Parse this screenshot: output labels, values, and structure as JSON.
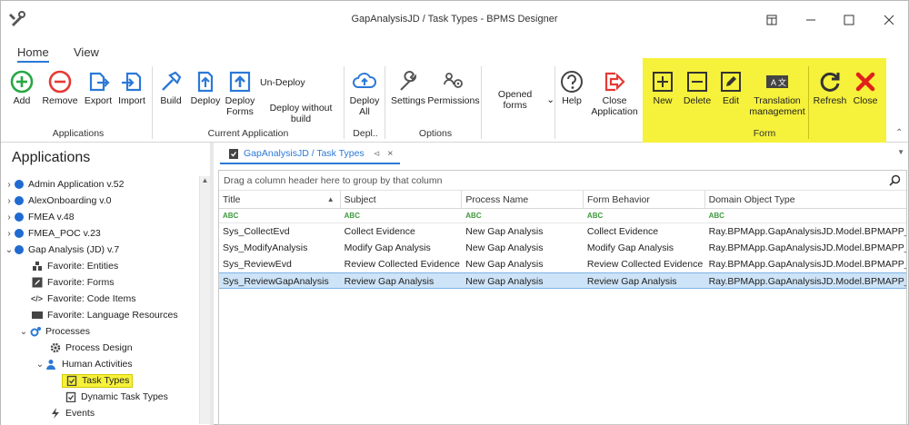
{
  "window": {
    "title": "GapAnalysisJD / Task Types - BPMS Designer"
  },
  "menu": {
    "tabs": [
      "Home",
      "View"
    ]
  },
  "ribbon": {
    "buttons": {
      "add": "Add",
      "remove": "Remove",
      "export": "Export",
      "import": "Import",
      "build": "Build",
      "deploy": "Deploy",
      "deploy_forms": "Deploy Forms",
      "undeploy": "Un-Deploy",
      "deploy_without_build": "Deploy without build",
      "deploy_all": "Deploy All",
      "settings": "Settings",
      "permissions": "Permissions",
      "opened_forms": "Opened forms",
      "help": "Help",
      "close_application": "Close Application",
      "new": "New",
      "delete": "Delete",
      "edit": "Edit",
      "translation_management": "Translation management",
      "refresh": "Refresh",
      "close": "Close"
    },
    "groups": {
      "applications": "Applications",
      "current_application": "Current Application",
      "depl": "Depl..",
      "options": "Options",
      "form": "Form"
    },
    "colors": {
      "accent": "#2b79d6",
      "highlight": "#f6f13a",
      "add_green": "#28a745",
      "remove_red": "#e53935",
      "close_red": "#e0201b"
    }
  },
  "left_panel": {
    "title": "Applications",
    "tree": [
      {
        "label": "Admin Application v.52"
      },
      {
        "label": "AlexOnboarding v.0"
      },
      {
        "label": "FMEA v.48"
      },
      {
        "label": "FMEA_POC v.23"
      },
      {
        "label": "Gap Analysis (JD) v.7"
      },
      {
        "label": "Favorite: Entities"
      },
      {
        "label": "Favorite: Forms"
      },
      {
        "label": "Favorite: Code Items"
      },
      {
        "label": "Favorite: Language Resources"
      },
      {
        "label": "Processes"
      },
      {
        "label": "Process Design"
      },
      {
        "label": "Human Activities"
      },
      {
        "label": "Task Types"
      },
      {
        "label": "Dynamic Task Types"
      },
      {
        "label": "Events"
      }
    ]
  },
  "main": {
    "tab_label": "GapAnalysisJD / Task Types",
    "group_hint": "Drag a column header here to group by that column",
    "columns": [
      "Title",
      "Subject",
      "Process Name",
      "Form Behavior",
      "Domain Object Type"
    ],
    "filter_glyph": "ABC",
    "rows": [
      [
        "Sys_CollectEvd",
        "Collect Evidence",
        "New Gap Analysis",
        "Collect Evidence",
        "Ray.BPMApp.GapAnalysisJD.Model.BPMAPP_Gap"
      ],
      [
        "Sys_ModifyAnalysis",
        "Modify Gap Analysis",
        "New Gap Analysis",
        "Modify Gap Analysis",
        "Ray.BPMApp.GapAnalysisJD.Model.BPMAPP_Gap"
      ],
      [
        "Sys_ReviewEvd",
        "Review Collected Evidence",
        "New Gap Analysis",
        "Review Collected Evidence",
        "Ray.BPMApp.GapAnalysisJD.Model.BPMAPP_Gap"
      ],
      [
        "Sys_ReviewGapAnalysis",
        "Review Gap Analysis",
        "New Gap Analysis",
        "Review Gap Analysis",
        "Ray.BPMApp.GapAnalysisJD.Model.BPMAPP_Gap"
      ]
    ]
  }
}
